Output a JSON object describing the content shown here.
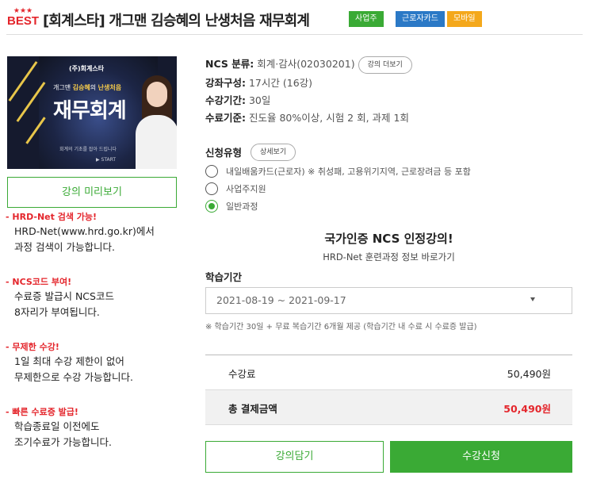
{
  "header": {
    "stars": "★★★",
    "best_label": "BEST",
    "title": "[회계스타] 개그맨 김승혜의 난생처음 재무회계",
    "tags": [
      "사업주",
      "근로자카드",
      "모바일"
    ],
    "colors": {
      "biz": "#3aaa35",
      "card": "#2b79c6",
      "mobile": "#f4a81b",
      "accent_red": "#e4262c"
    }
  },
  "thumbnail": {
    "brand": "(주)회계스타",
    "line1_prefix": "개그맨 ",
    "line1_name": "김승혜",
    "line1_mid": "의 ",
    "line1_hl": "난생처음",
    "big_text": "재무회계",
    "sub": "회계의 기초를 잡아 드립니다",
    "start": "START"
  },
  "preview_button": "강의 미리보기",
  "features": [
    {
      "title": "- HRD-Net 검색 가능!",
      "lines": [
        "HRD-Net(www.hrd.go.kr)에서",
        "과정 검색이 가능합니다."
      ]
    },
    {
      "title": "- NCS코드 부여!",
      "lines": [
        "수료증 발급시 NCS코드",
        "8자리가 부여됩니다."
      ]
    },
    {
      "title": "- 무제한 수강!",
      "lines": [
        "1일 최대 수강 제한이 없어",
        "무제한으로 수강 가능합니다."
      ]
    },
    {
      "title": "- 빠른 수료증 발급!",
      "lines": [
        "학습종료일 이전에도",
        "조기수료가 가능합니다."
      ]
    }
  ],
  "info": {
    "ncs_label": "NCS 분류:",
    "ncs_value": "회계·감사(02030201)",
    "ncs_more": "강의 더보기",
    "composition_label": "강좌구성:",
    "composition_value": "17시간 (16강)",
    "duration_label": "수강기간:",
    "duration_value": "30일",
    "completion_label": "수료기준:",
    "completion_value": "진도율 80%이상, 시험 2 회, 과제 1회"
  },
  "apply": {
    "title": "신청유형",
    "detail_button": "상세보기",
    "options": [
      {
        "label": "내일배움카드(근로자) ※ 취성패, 고용위기지역, 근로장려금 등 포함",
        "selected": false
      },
      {
        "label": "사업주지원",
        "selected": false
      },
      {
        "label": "일반과정",
        "selected": true
      }
    ]
  },
  "ncs_banner": {
    "headline": "국가인증 NCS 인정강의!",
    "link": "HRD-Net 훈련과정 정보 바로가기"
  },
  "period": {
    "label": "학습기간",
    "value": "2021-08-19 ~ 2021-09-17",
    "note": "※ 학습기간 30일 + 무료 복습기간 6개월 제공 (학습기간 내 수료 시 수료증 발급)"
  },
  "price": {
    "fee_label": "수강료",
    "fee_value": "50,490원",
    "total_label": "총 결제금액",
    "total_value": "50,490원"
  },
  "actions": {
    "cart": "강의담기",
    "enroll": "수강신청"
  }
}
